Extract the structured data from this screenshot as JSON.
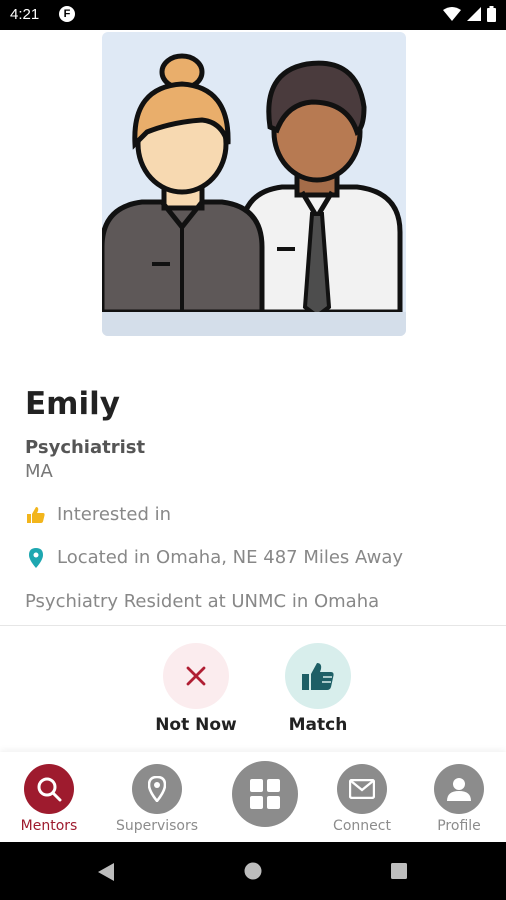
{
  "status_bar": {
    "time": "4:21"
  },
  "profile": {
    "name": "Emily",
    "role": "Psychiatrist",
    "degree": "MA",
    "interest_text": "Interested in",
    "location_text": "Located in Omaha, NE 487 Miles Away",
    "bio": "Psychiatry Resident at UNMC in Omaha"
  },
  "actions": {
    "not_now_label": "Not Now",
    "match_label": "Match"
  },
  "nav": {
    "mentors": "Mentors",
    "supervisors": "Supervisors",
    "connect": "Connect",
    "profile": "Profile"
  },
  "colors": {
    "brand": "#9e1b2e",
    "match_bg": "#d8eeec",
    "match_icon": "#1e5f66",
    "not_now_bg": "#fbecee",
    "inactive": "#8c8c8c"
  },
  "icons": {
    "interest": "thumbs-up-icon",
    "location": "map-pin-icon",
    "not_now": "close-icon",
    "match": "thumbs-up-icon"
  }
}
